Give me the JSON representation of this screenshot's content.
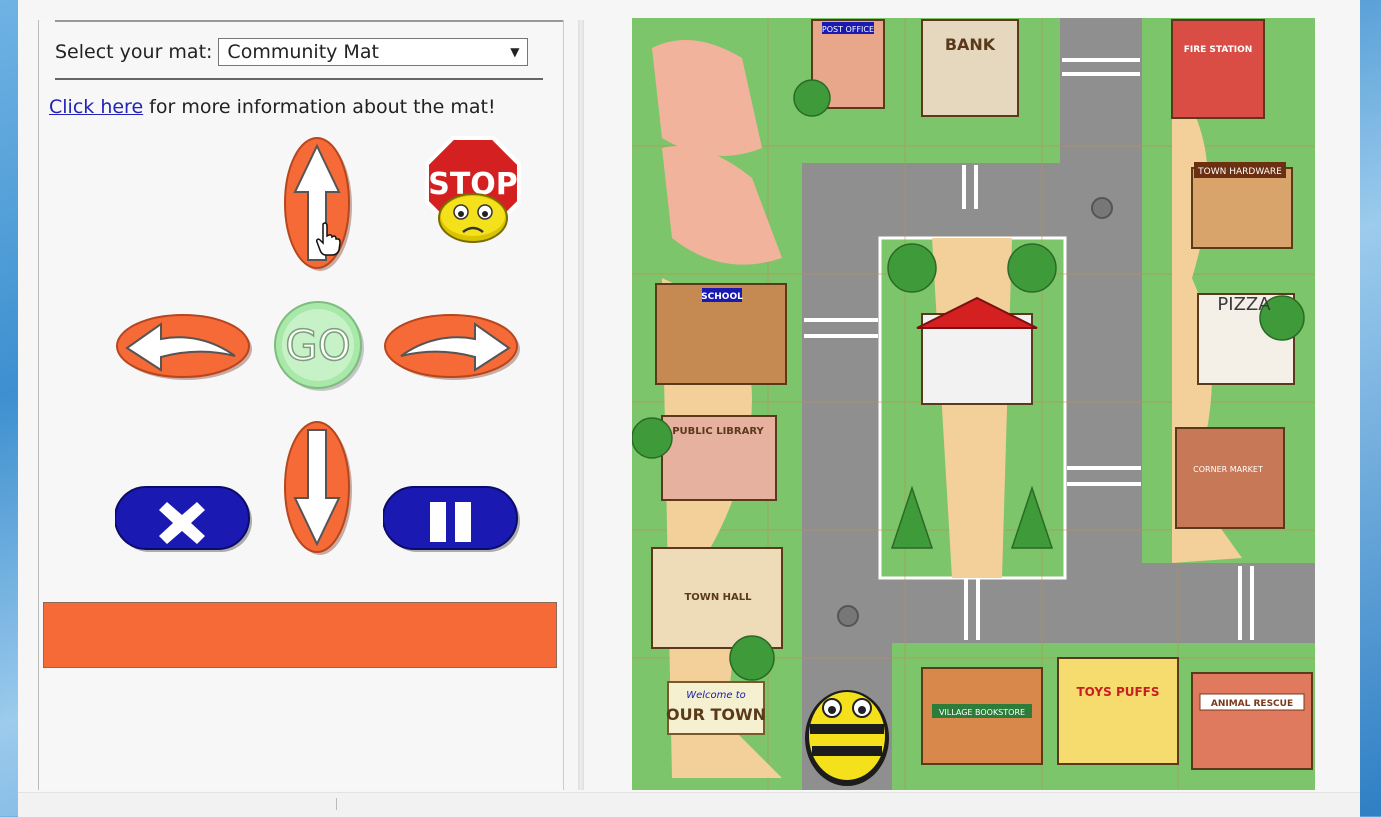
{
  "controls": {
    "select_label": "Select your mat:",
    "selected_mat": "Community Mat",
    "info_link": "Click here",
    "info_text": " for more information about the mat!",
    "stop_sign_text": "STOP",
    "go_text": "GO"
  },
  "map": {
    "signs": {
      "post_office": "POST OFFICE",
      "bank": "BANK",
      "fire_station": "FIRE STATION",
      "town_hardware": "TOWN HARDWARE",
      "school": "SCHOOL",
      "pizza": "PIZZA",
      "public_library": "PUBLIC LIBRARY",
      "corner_market": "CORNER MARKET",
      "town_hall": "TOWN HALL",
      "welcome_to": "Welcome to",
      "our_town": "OUR TOWN",
      "village_bookstore": "VILLAGE BOOKSTORE",
      "toys_puffs": "TOYS PUFFS",
      "animal_rescue": "ANIMAL RESCUE"
    }
  },
  "colors": {
    "orange": "#f56a37",
    "blue_button": "#1a1ab3",
    "go_green": "#a8e8a8",
    "stop_red": "#d42020",
    "grass": "#7cc56a",
    "road": "#8f8f8f",
    "path": "#f3cf9a"
  },
  "icons": [
    "arrow-up-icon",
    "arrow-down-icon",
    "turn-left-icon",
    "turn-right-icon",
    "close-icon",
    "pause-icon",
    "stop-sign-icon",
    "bee-bot-icon",
    "hand-cursor-icon"
  ]
}
